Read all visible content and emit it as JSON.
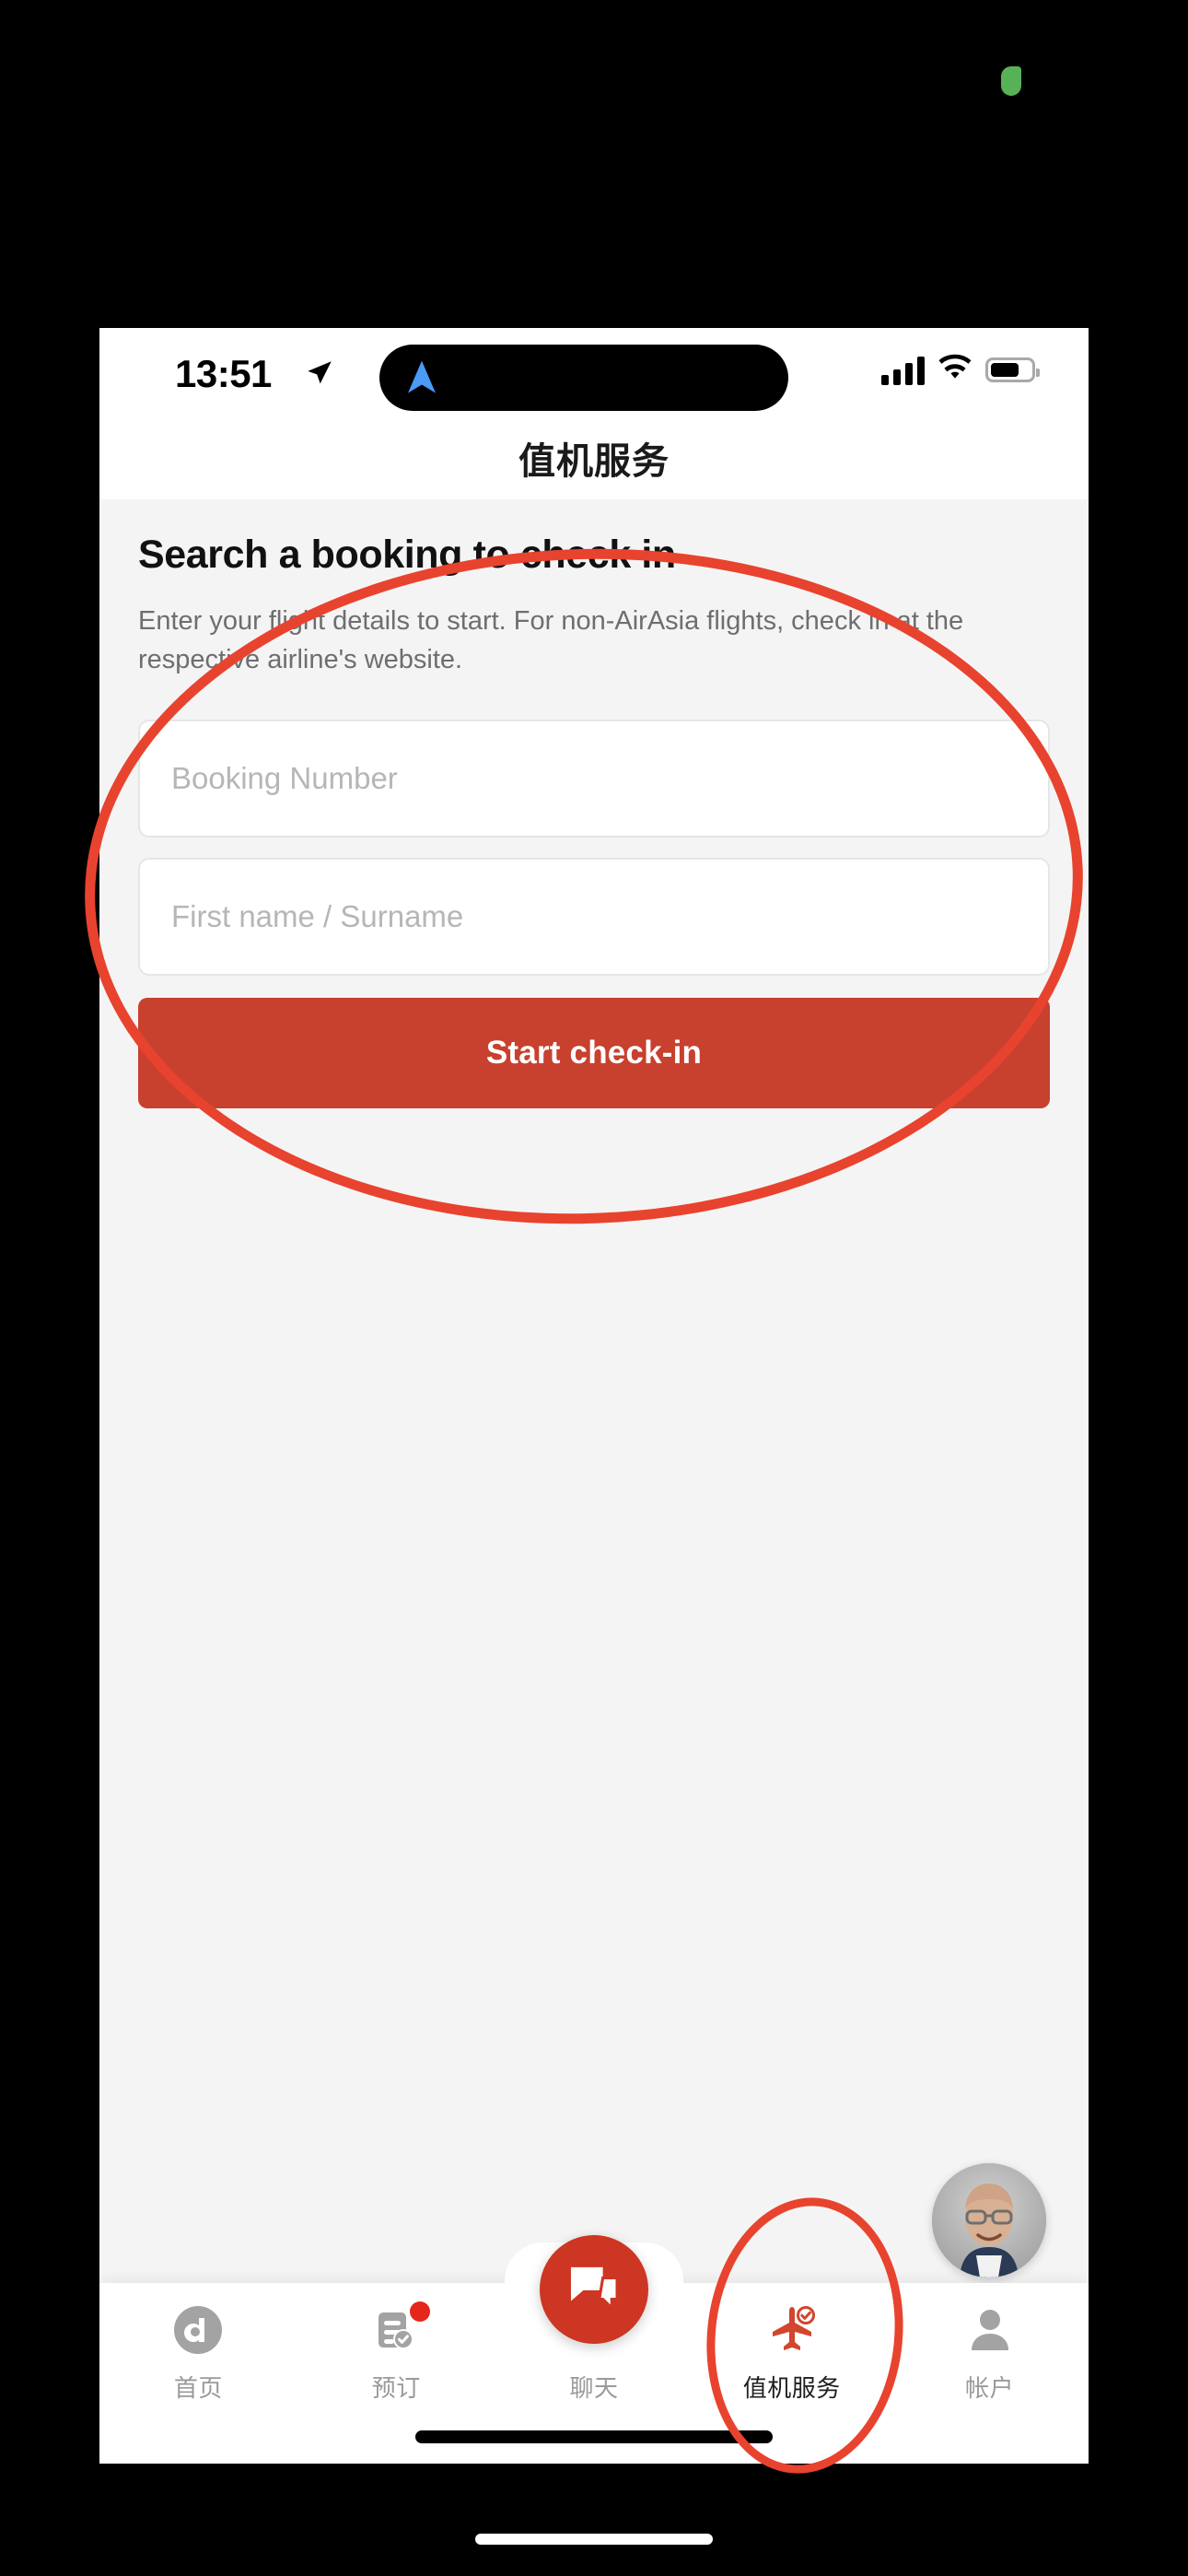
{
  "status_bar": {
    "time": "13:51",
    "location_icon": "location-arrow-icon",
    "navigation_icon": "navigation-arrow-icon",
    "signal_icon": "cellular-signal-icon",
    "wifi_icon": "wifi-icon",
    "battery_icon": "battery-icon",
    "battery_level_pct": 62
  },
  "header": {
    "title": "值机服务"
  },
  "main": {
    "page_title": "Search a booking to check in",
    "description": "Enter your flight details to start. For non-AirAsia flights, check in at the respective airline's website.",
    "fields": [
      {
        "name": "booking-number",
        "placeholder": "Booking Number",
        "value": ""
      },
      {
        "name": "first-name-surname",
        "placeholder": "First name / Surname",
        "value": ""
      }
    ],
    "cta_label": "Start check-in"
  },
  "avatar": {
    "name": "user-avatar",
    "description": "profile photo"
  },
  "fab": {
    "icon": "chat-bubbles-icon"
  },
  "tabbar": {
    "items": [
      {
        "label": "首页",
        "icon": "airasia-logo-icon",
        "active": false,
        "badge": false
      },
      {
        "label": "预订",
        "icon": "booking-document-icon",
        "active": false,
        "badge": true
      },
      {
        "label": "聊天",
        "icon": "chat-icon",
        "active": false,
        "badge": false
      },
      {
        "label": "值机服务",
        "icon": "plane-check-icon",
        "active": true,
        "badge": false
      },
      {
        "label": "帐户",
        "icon": "person-icon",
        "active": false,
        "badge": false
      }
    ]
  },
  "annotations": {
    "color": "#e8432e",
    "shapes": [
      {
        "name": "highlight-ellipse-checkin-form",
        "type": "ellipse"
      },
      {
        "name": "highlight-ellipse-checkin-tab",
        "type": "ellipse"
      }
    ]
  },
  "colors": {
    "brand_red": "#c8402e",
    "fab_red": "#cc3622",
    "badge_red": "#e4261b",
    "annotation_red": "#e8432e",
    "screen_bg": "#f4f4f4",
    "card_bg": "#ffffff",
    "muted_text": "#6e6e6e",
    "placeholder_text": "#b6b6b6"
  }
}
